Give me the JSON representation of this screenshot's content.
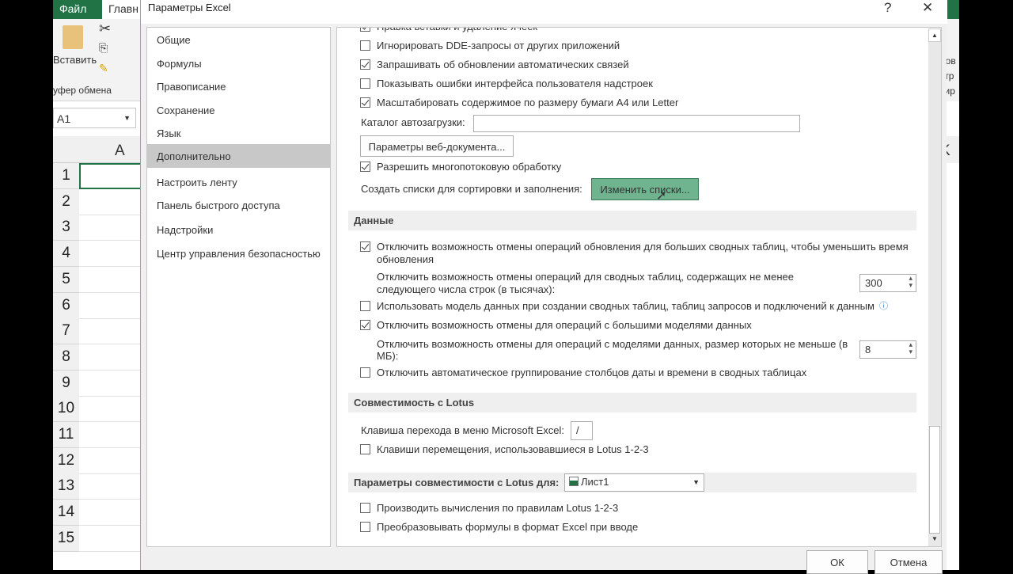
{
  "excel": {
    "file_tab": "Файл",
    "home_tab": "Главн",
    "paste_label": "Вставить",
    "clipboard_group": "уфер обмена",
    "name_box": "A1",
    "column_a": "A",
    "column_k": "K",
    "rows": [
      "1",
      "2",
      "3",
      "4",
      "5",
      "6",
      "7",
      "8",
      "9",
      "10",
      "11",
      "12",
      "13",
      "14",
      "15"
    ],
    "right_ribbon": [
      "ров",
      "ьтр",
      "тир"
    ]
  },
  "dialog": {
    "title": "Параметры Excel",
    "help": "?",
    "close": "✕"
  },
  "nav": {
    "items": [
      {
        "label": "Общие"
      },
      {
        "label": "Формулы"
      },
      {
        "label": "Правописание"
      },
      {
        "label": "Сохранение"
      },
      {
        "label": "Язык"
      },
      {
        "label": "Дополнительно",
        "selected": true
      },
      {
        "label": "Настроить ленту"
      },
      {
        "label": "Панель быстрого доступа"
      },
      {
        "label": "Надстройки"
      },
      {
        "label": "Центр управления безопасностью"
      }
    ]
  },
  "general": {
    "items": [
      {
        "label": "Правка вставки и удаление ячеек",
        "checked": true
      },
      {
        "label": "Игнорировать DDE-запросы от других приложений",
        "checked": false
      },
      {
        "label": "Запрашивать об обновлении автоматических связей",
        "checked": true
      },
      {
        "label": "Показывать ошибки интерфейса пользователя надстроек",
        "checked": false
      },
      {
        "label": "Масштабировать содержимое по размеру бумаги A4 или Letter",
        "checked": true
      }
    ],
    "autoload_label": "Каталог автозагрузки:",
    "autoload_value": "",
    "web_options_button": "Параметры веб-документа...",
    "multithread": {
      "label": "Разрешить многопотоковую обработку",
      "checked": true
    },
    "lists_label": "Создать списки для сортировки и заполнения:",
    "edit_lists_button": "Изменить списки...",
    "edit_lists_color": "#6fb38f"
  },
  "data": {
    "header": "Данные",
    "item1": {
      "label": "Отключить возможность отмены операций обновления для больших сводных таблиц, чтобы уменьшить время",
      "label2": "обновления",
      "checked": true
    },
    "rows_label": "Отключить возможность отмены операций для сводных таблиц, содержащих не менее",
    "rows_label2": "следующего числа строк (в тысячах):",
    "rows_value": "300",
    "item2": {
      "label": "Использовать модель данных при создании сводных таблиц, таблиц запросов и подключений к данным",
      "checked": false
    },
    "item3": {
      "label": "Отключить возможность отмены для операций с большими моделями данных",
      "checked": true
    },
    "size_label": "Отключить возможность отмены для операций с моделями данных, размер которых не меньше (в",
    "size_label2": "МБ):",
    "size_value": "8",
    "item4": {
      "label": "Отключить автоматическое группирование столбцов даты и времени в сводных таблицах",
      "checked": false
    }
  },
  "lotus": {
    "header": "Совместимость с Lotus",
    "menu_key_label": "Клавиша перехода в меню Microsoft Excel:",
    "menu_key_value": "/",
    "nav_keys": {
      "label": "Клавиши перемещения, использовавшиеся в Lotus 1-2-3",
      "checked": false
    }
  },
  "lotus_sheet": {
    "header": "Параметры совместимости с Lotus для:",
    "sheet": "Лист1",
    "item1": {
      "label": "Производить вычисления по правилам Lotus 1-2-3",
      "checked": false
    },
    "item2": {
      "label": "Преобразовывать формулы в формат Excel при вводе",
      "checked": false
    }
  },
  "footer": {
    "ok": "ОК",
    "cancel": "Отмена"
  }
}
